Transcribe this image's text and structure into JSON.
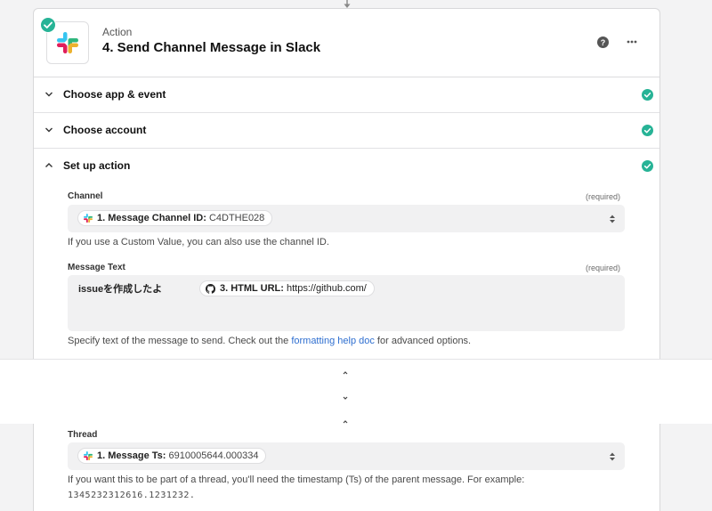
{
  "step": {
    "kicker": "Action",
    "title": "4. Send Channel Message in Slack"
  },
  "sections": [
    {
      "label": "Choose app & event"
    },
    {
      "label": "Choose account"
    },
    {
      "label": "Set up action"
    }
  ],
  "fields": {
    "channel": {
      "label": "Channel",
      "required": "(required)",
      "pill_label": "1. Message Channel ID:",
      "pill_value": "C4DTHE028",
      "hint": "If you use a Custom Value, you can also use the channel ID."
    },
    "message_text": {
      "label": "Message Text",
      "required": "(required)",
      "prefix": "issueを作成したよ",
      "pill_label": "3. HTML URL:",
      "pill_value": "https://github.com/",
      "hint_before": "Specify text of the message to send. Check out the ",
      "hint_link": "formatting help doc",
      "hint_after": " for advanced options."
    },
    "thread": {
      "label": "Thread",
      "pill_label": "1. Message Ts:",
      "pill_value": "6910005644.000334",
      "hint_line1": "If you want this to be part of a thread, you'll need the timestamp (Ts) of the parent message. For example:",
      "hint_line2": "1345232312616.1231232."
    }
  },
  "colors": {
    "success": "#27b396",
    "link": "#2f6fd0",
    "field_bg": "#f1f1f2"
  },
  "icons": {
    "app": "slack-logo",
    "status": "check-circle",
    "help": "question-circle",
    "more": "ellipsis",
    "github": "github-logo"
  }
}
